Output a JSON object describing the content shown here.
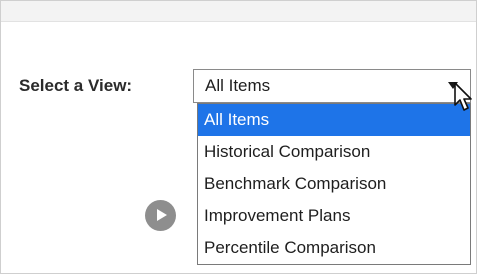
{
  "view_selector": {
    "label": "Select a View:",
    "selected_value": "All Items",
    "options": [
      {
        "label": "All Items",
        "selected": true
      },
      {
        "label": "Historical Comparison",
        "selected": false
      },
      {
        "label": "Benchmark Comparison",
        "selected": false
      },
      {
        "label": "Improvement Plans",
        "selected": false
      },
      {
        "label": "Percentile Comparison",
        "selected": false
      }
    ]
  },
  "icons": {
    "play": "play-icon",
    "dropdown_arrow": "chevron-down-icon",
    "cursor": "mouse-pointer-icon"
  },
  "colors": {
    "highlight": "#1e74e8",
    "play_button": "#8e8e8e"
  }
}
